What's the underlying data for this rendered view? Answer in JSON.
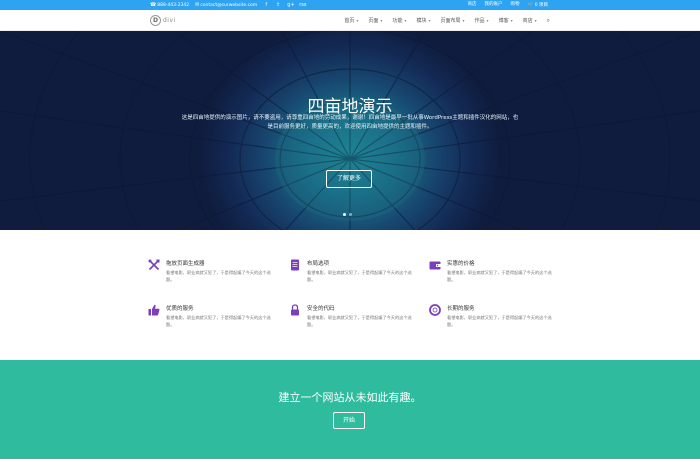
{
  "topbar": {
    "phone": "888-443-2342",
    "email": "contact@surwebsite.com",
    "social": [
      "f",
      "t",
      "g+",
      "rss"
    ],
    "links": [
      "商店",
      "我的账户",
      "购物",
      "0 项目"
    ]
  },
  "header": {
    "logo_letter": "D",
    "logo_text": "divi",
    "nav": [
      {
        "label": "首页",
        "dropdown": true
      },
      {
        "label": "页面",
        "dropdown": true
      },
      {
        "label": "功能",
        "dropdown": true
      },
      {
        "label": "模块",
        "dropdown": true
      },
      {
        "label": "页面布局",
        "dropdown": true
      },
      {
        "label": "作品",
        "dropdown": true
      },
      {
        "label": "博客",
        "dropdown": true
      },
      {
        "label": "商店",
        "dropdown": true
      }
    ]
  },
  "hero": {
    "title": "四亩地演示",
    "description": "这是四亩地提供的演示图片，请不要盗用，请尊重四亩地的劳动成果，谢谢！四亩地是最早一批从事WordPress主题和插件汉化的网站，也是目前服务更好，质量更高的，欢迎使用四亩地提供的主题和插件。",
    "button": "了解更多",
    "slides": 2,
    "active_slide": 0
  },
  "features": [
    {
      "icon": "tools-icon",
      "title": "拖放页面生成器",
      "text": "看望电影，职业病就又犯了，于是得起编了今天的这个选题。"
    },
    {
      "icon": "document-icon",
      "title": "布局选项",
      "text": "看望电影，职业病就又犯了，于是得起编了今天的这个选题。"
    },
    {
      "icon": "wallet-icon",
      "title": "实惠的价格",
      "text": "看望电影，职业病就又犯了，于是得起编了今天的这个选题。"
    },
    {
      "icon": "thumbs-up-icon",
      "title": "优质的服务",
      "text": "看望电影，职业病就又犯了，于是得起编了今天的这个选题。"
    },
    {
      "icon": "lock-icon",
      "title": "安全的代码",
      "text": "看望电影，职业病就又犯了，于是得起编了今天的这个选题。"
    },
    {
      "icon": "lifebuoy-icon",
      "title": "长期的服务",
      "text": "看望电影，职业病就又犯了，于是得起编了今天的这个选题。"
    }
  ],
  "cta": {
    "title": "建立一个网站从未如此有趣。",
    "button": "开始"
  },
  "colors": {
    "topbar": "#2ea3f2",
    "accent": "#7b3fbb",
    "cta": "#2fbc9e"
  }
}
